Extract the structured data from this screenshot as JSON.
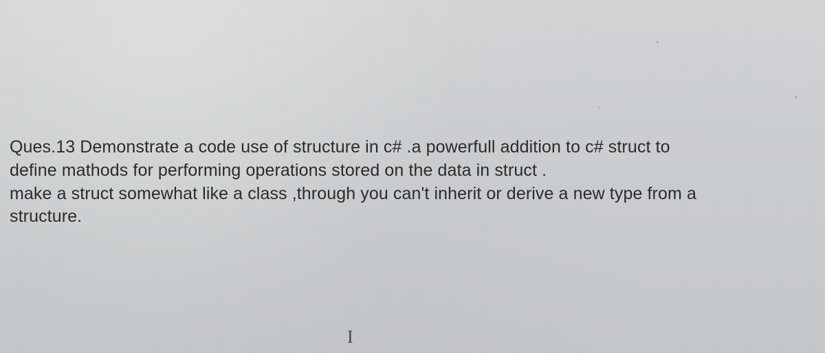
{
  "question": {
    "number_label": "Ques.13",
    "line1": "Ques.13 Demonstrate a code use of structure in c# .a powerfull addition to c# struct to",
    "line2": "define mathods for performing operations stored on the data in struct .",
    "line3": "make a struct somewhat like a class ,through you can't inherit or derive a new type from a",
    "line4": "structure."
  },
  "cursor_glyph": "I"
}
